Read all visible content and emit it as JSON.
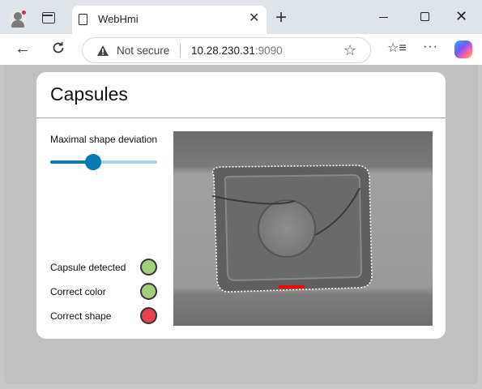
{
  "browser": {
    "tab_title": "WebHmi",
    "tab_close": "✕",
    "new_tab": "+",
    "not_secure": "Not secure",
    "url_host": "10.28.230.31",
    "url_port": ":9090",
    "back": "←",
    "star": "☆",
    "favorites": "☆≡",
    "more": "···",
    "window_close": "✕"
  },
  "page": {
    "title": "Capsules",
    "slider": {
      "label": "Maximal shape deviation",
      "value_fraction": 0.4
    },
    "status": [
      {
        "label": "Capsule detected",
        "state": "ok",
        "color": "#a3cf7a"
      },
      {
        "label": "Correct color",
        "state": "ok",
        "color": "#a3cf7a"
      },
      {
        "label": "Correct shape",
        "state": "error",
        "color": "#ec4050"
      }
    ]
  },
  "colors": {
    "accent": "#0a77b6",
    "track": "#a9d1e8",
    "ok": "#a3cf7a",
    "error": "#ec4050",
    "defect_marker": "#ff0000"
  }
}
